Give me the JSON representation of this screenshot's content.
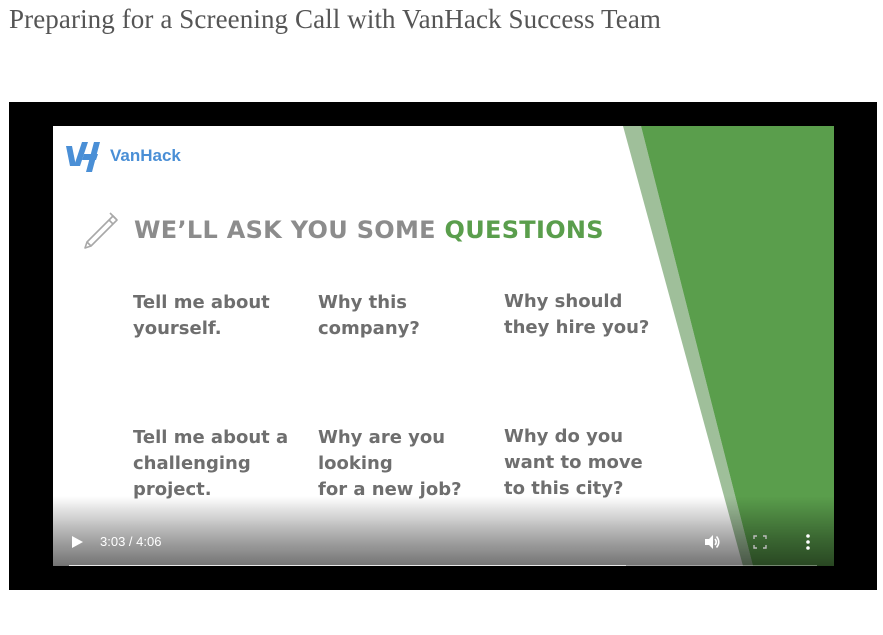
{
  "page": {
    "title": "Preparing for a Screening Call with VanHack Success Team"
  },
  "video": {
    "logo_text": "VanHack",
    "heading_main": "WE’LL ASK YOU SOME ",
    "heading_accent": "QUESTIONS",
    "questions": [
      "Tell me about\nyourself.",
      "Why this\ncompany?",
      "Why should\nthey hire you?",
      "Tell me about a\nchallenging\nproject.",
      "Why are you\nlooking\nfor a new job?",
      "Why do you\nwant to move\nto this city?"
    ],
    "colors": {
      "accent_green": "#5a9e4c",
      "logo_blue": "#4a8fd6"
    }
  },
  "controls": {
    "time": "3:03 / 4:06",
    "progress_fraction": 0.744,
    "icons": [
      "play-icon",
      "volume-icon",
      "fullscreen-icon",
      "more-options-icon"
    ]
  }
}
